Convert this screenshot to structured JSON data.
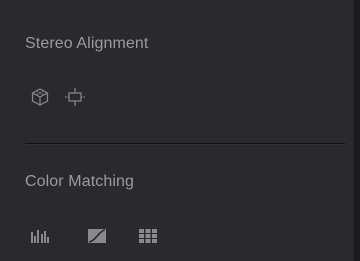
{
  "panel": {
    "sections": [
      {
        "title": "Stereo Alignment",
        "icons": [
          "stereo-cube-icon",
          "stereo-align-icon"
        ]
      },
      {
        "title": "Color Matching",
        "icons": [
          "histogram-match-icon",
          "curve-match-icon",
          "grid-match-icon"
        ]
      }
    ]
  },
  "colors": {
    "panel_bg": "#2a2a2c",
    "text": "#9b9b9e",
    "icon": "#8a8a8d"
  }
}
